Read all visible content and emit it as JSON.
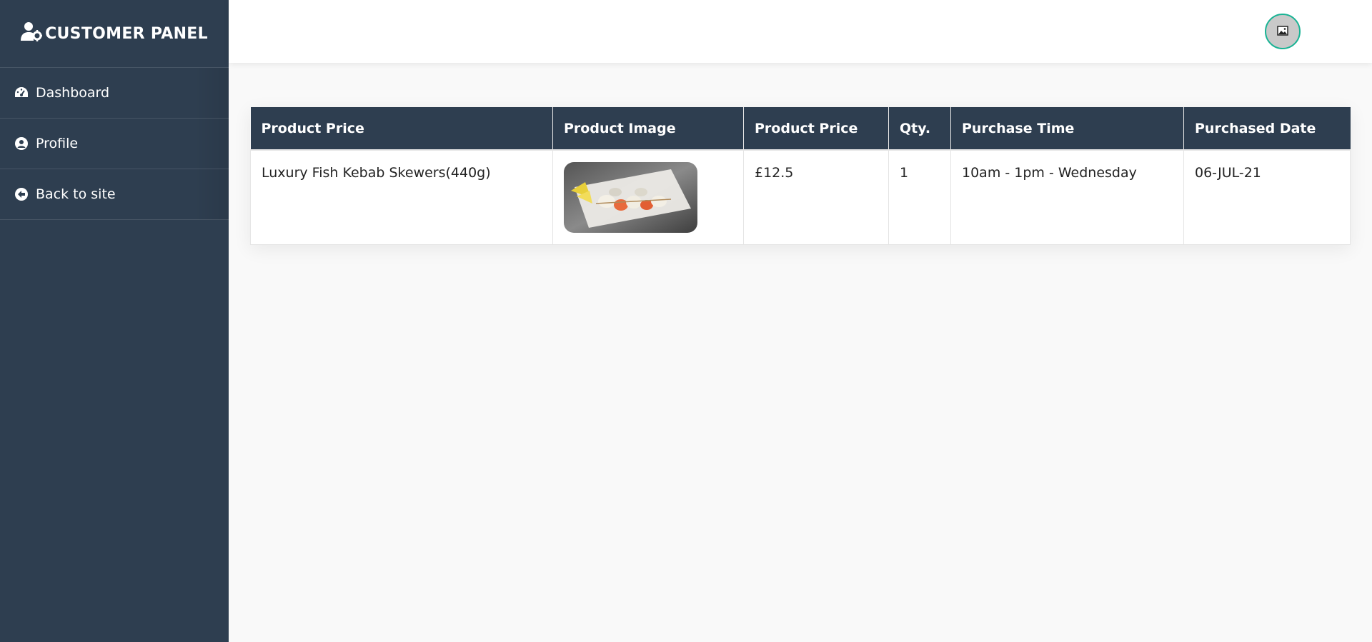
{
  "sidebar": {
    "title": "CUSTOMER PANEL",
    "items": [
      {
        "label": "Dashboard",
        "icon": "tachometer-icon"
      },
      {
        "label": "Profile",
        "icon": "user-circle-icon"
      },
      {
        "label": "Back to site",
        "icon": "arrow-circle-left-icon"
      }
    ]
  },
  "header": {
    "avatar_icon": "broken-image-icon"
  },
  "table": {
    "columns": [
      "Product Price",
      "Product Image",
      "Product Price",
      "Qty.",
      "Purchase Time",
      "Purchased Date"
    ],
    "rows": [
      {
        "product_name": "Luxury Fish Kebab Skewers(440g)",
        "image_icon": "fish-kebab-photo",
        "price": "£12.5",
        "qty": "1",
        "purchase_time": "10am - 1pm - Wednesday",
        "purchased_date": "06-JUL-21"
      }
    ]
  },
  "colors": {
    "sidebar_bg": "#2e3e50",
    "avatar_border": "#19b394",
    "page_bg": "#f9f9f9"
  }
}
